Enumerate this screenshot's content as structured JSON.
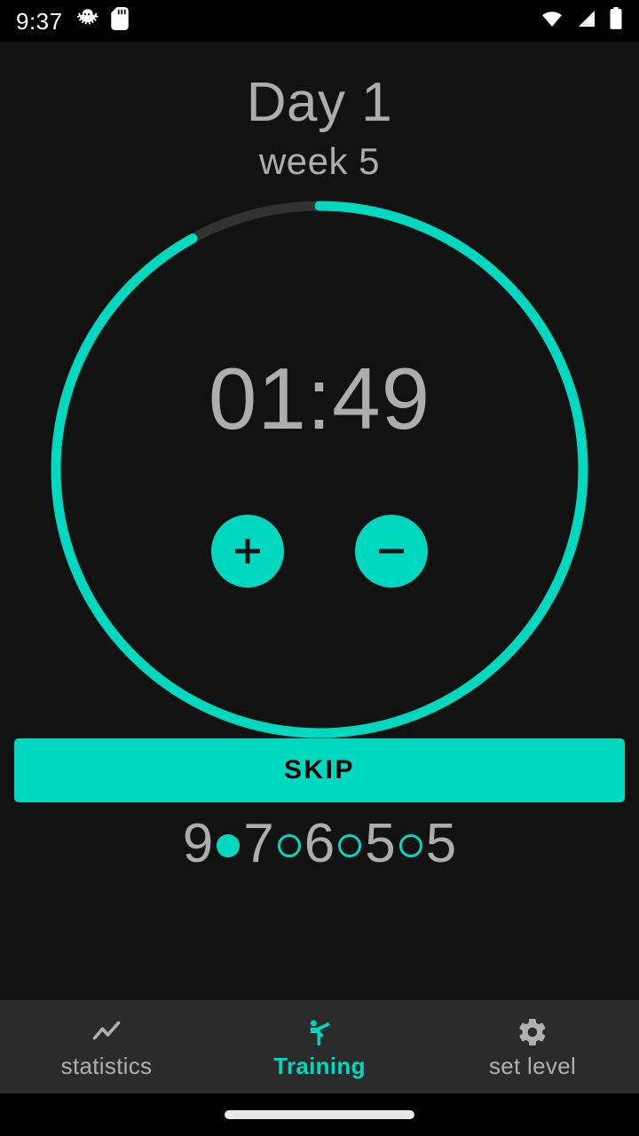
{
  "statusbar": {
    "time": "9:37",
    "left_icons": [
      "bug-icon",
      "sd-card-icon"
    ],
    "right_icons": [
      "wifi-icon",
      "cell-signal-icon",
      "battery-icon"
    ]
  },
  "header": {
    "day_title": "Day 1",
    "week_subtitle": "week 5"
  },
  "timer": {
    "value": "01:49",
    "progress_percent": 92,
    "ring_color": "#00d9c0",
    "ring_track_color": "#323232",
    "increase_label": "+",
    "decrease_label": "−",
    "increase_name": "plus-icon",
    "decrease_name": "minus-icon"
  },
  "skip": {
    "label": "SKIP",
    "color": "#00d9c0",
    "text_color": "#000000"
  },
  "reps": {
    "sequence": [
      {
        "type": "number",
        "value": "9"
      },
      {
        "type": "dot",
        "state": "filled"
      },
      {
        "type": "number",
        "value": "7"
      },
      {
        "type": "dot",
        "state": "empty"
      },
      {
        "type": "number",
        "value": "6"
      },
      {
        "type": "dot",
        "state": "empty"
      },
      {
        "type": "number",
        "value": "5"
      },
      {
        "type": "dot",
        "state": "empty"
      },
      {
        "type": "number",
        "value": "5"
      }
    ],
    "dot_color": "#00d9c0",
    "number_color": "#adadad"
  },
  "bottomnav": {
    "active_index": 1,
    "active_color": "#00d9c0",
    "inactive_color": "#b0b0b0",
    "items": [
      {
        "label": "statistics",
        "icon": "trending-line-icon"
      },
      {
        "label": "Training",
        "icon": "kick-figure-icon"
      },
      {
        "label": "set level",
        "icon": "gear-icon"
      }
    ]
  },
  "gesturebar": {
    "name": "home-gesture-pill"
  }
}
